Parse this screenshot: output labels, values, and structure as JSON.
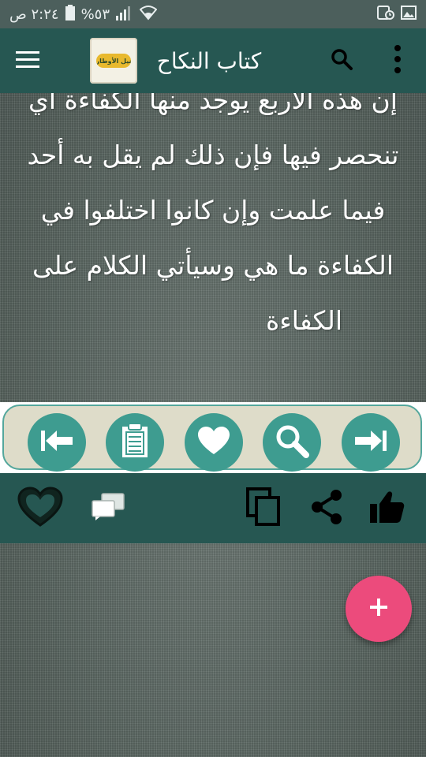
{
  "status_bar": {
    "time": "٢:٢٤ ص",
    "battery": "%٥٣"
  },
  "app_bar": {
    "title": "كتاب  النكاح",
    "logo_text": "نيل الأوطار"
  },
  "content": {
    "lines": [
      "إن هذه الأربع يوجد منها الكفاءة أي",
      "تنحصر فيها فإن ذلك لم يقل به أحد",
      "فيما علمت وإن كانوا اختلفوا في",
      "الكفاءة ما هي وسيأتي الكلام على",
      "الكفاءة"
    ]
  },
  "colors": {
    "status_bar": "#4c5f5c",
    "app_bar": "#265752",
    "nav_button": "#3e9c90",
    "nav_panel": "#dedcc9",
    "fab": "#ec4b7c"
  },
  "icons": {
    "nav": [
      "first-page-icon",
      "contents-icon",
      "favorite-icon",
      "search-icon",
      "last-page-icon"
    ],
    "actions": [
      "favorite-outline-icon",
      "comments-icon",
      "copy-icon",
      "share-icon",
      "like-icon"
    ],
    "fab": "add-icon"
  }
}
